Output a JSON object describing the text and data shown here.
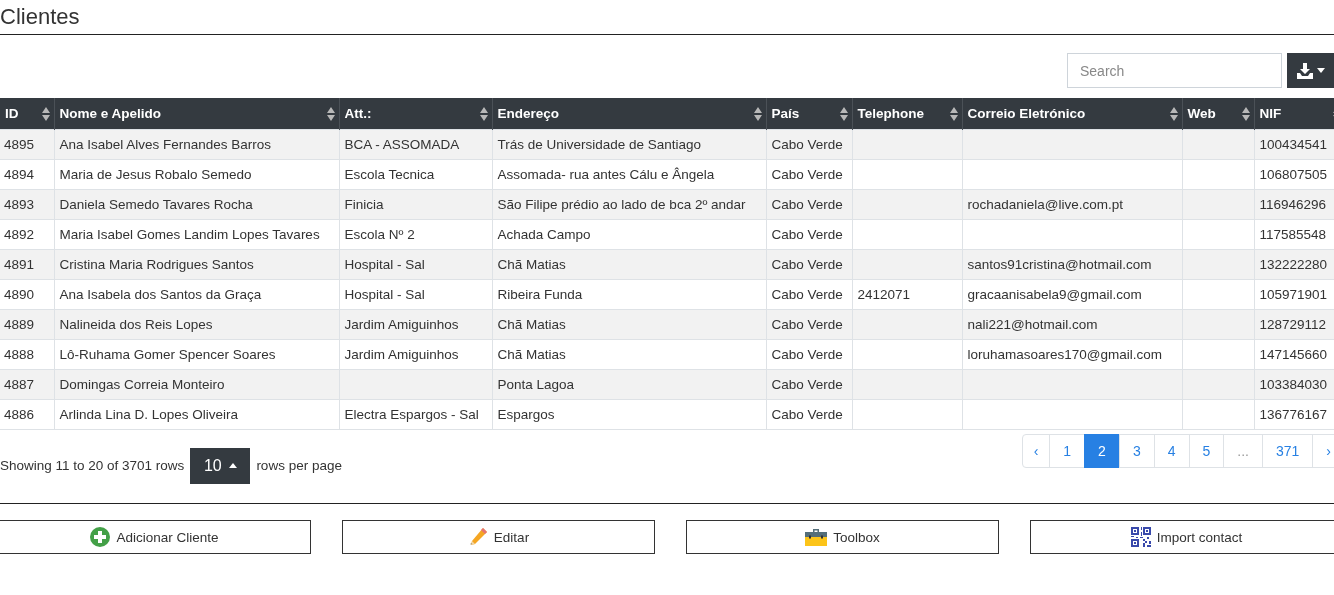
{
  "title": "Clientes",
  "search": {
    "placeholder": "Search"
  },
  "table": {
    "columns": [
      "ID",
      "Nome e Apelido",
      "Att.:",
      "Endereço",
      "País",
      "Telephone",
      "Correio Eletrónico",
      "Web",
      "NIF"
    ],
    "rows": [
      [
        "4895",
        "Ana Isabel Alves Fernandes Barros",
        "BCA - ASSOMADA",
        "Trás de Universidade de Santiago",
        "Cabo Verde",
        null,
        null,
        null,
        "100434541"
      ],
      [
        "4894",
        "Maria de Jesus Robalo Semedo",
        "Escola Tecnica",
        "Assomada- rua antes Cálu e Ângela",
        "Cabo Verde",
        null,
        null,
        null,
        "106807505"
      ],
      [
        "4893",
        "Daniela Semedo Tavares Rocha",
        "Finicia",
        "São Filipe prédio ao lado de bca 2º andar",
        "Cabo Verde",
        null,
        "rochadaniela@live.com.pt",
        null,
        "116946296"
      ],
      [
        "4892",
        "Maria Isabel Gomes Landim Lopes Tavares",
        "Escola Nº 2",
        "Achada Campo",
        "Cabo Verde",
        null,
        null,
        null,
        "117585548"
      ],
      [
        "4891",
        "Cristina Maria Rodrigues Santos",
        "Hospital - Sal",
        "Chã Matias",
        "Cabo Verde",
        null,
        "santos91cristina@hotmail.com",
        null,
        "132222280"
      ],
      [
        "4890",
        "Ana Isabela dos Santos da Graça",
        "Hospital - Sal",
        "Ribeira Funda",
        "Cabo Verde",
        "2412071",
        "gracaanisabela9@gmail.com",
        null,
        "105971901"
      ],
      [
        "4889",
        "Nalineida dos Reis Lopes",
        "Jardim Amiguinhos",
        "Chã Matias",
        "Cabo Verde",
        null,
        "nali221@hotmail.com",
        null,
        "128729112"
      ],
      [
        "4888",
        "Lô-Ruhama Gomer Spencer Soares",
        "Jardim Amiguinhos",
        "Chã Matias",
        "Cabo Verde",
        null,
        "loruhamasoares170@gmail.com",
        null,
        "147145660"
      ],
      [
        "4887",
        "Domingas Correia Monteiro",
        null,
        "Ponta Lagoa",
        "Cabo Verde",
        null,
        null,
        null,
        "103384030"
      ],
      [
        "4886",
        "Arlinda Lina D. Lopes Oliveira",
        "Electra Espargos - Sal",
        "Espargos",
        "Cabo Verde",
        null,
        null,
        null,
        "136776167"
      ]
    ]
  },
  "footer": {
    "summary": "Showing 11 to 20 of 3701 rows",
    "page_size": "10",
    "page_size_suffix": "rows per page"
  },
  "pagination": [
    {
      "label": "‹",
      "kind": "prev",
      "selected": false
    },
    {
      "label": "1",
      "kind": "page",
      "selected": false
    },
    {
      "label": "2",
      "kind": "page",
      "selected": true
    },
    {
      "label": "3",
      "kind": "page",
      "selected": false
    },
    {
      "label": "4",
      "kind": "page",
      "selected": false
    },
    {
      "label": "5",
      "kind": "page",
      "selected": false
    },
    {
      "label": "...",
      "kind": "gap",
      "selected": false
    },
    {
      "label": "371",
      "kind": "page",
      "selected": false
    },
    {
      "label": "›",
      "kind": "next",
      "selected": false
    }
  ],
  "actions": [
    {
      "label": "Adicionar Cliente",
      "kind": "add"
    },
    {
      "label": "Editar",
      "kind": "edit"
    },
    {
      "label": "Toolbox",
      "kind": "toolbox"
    },
    {
      "label": "Import contact",
      "kind": "qr"
    }
  ]
}
